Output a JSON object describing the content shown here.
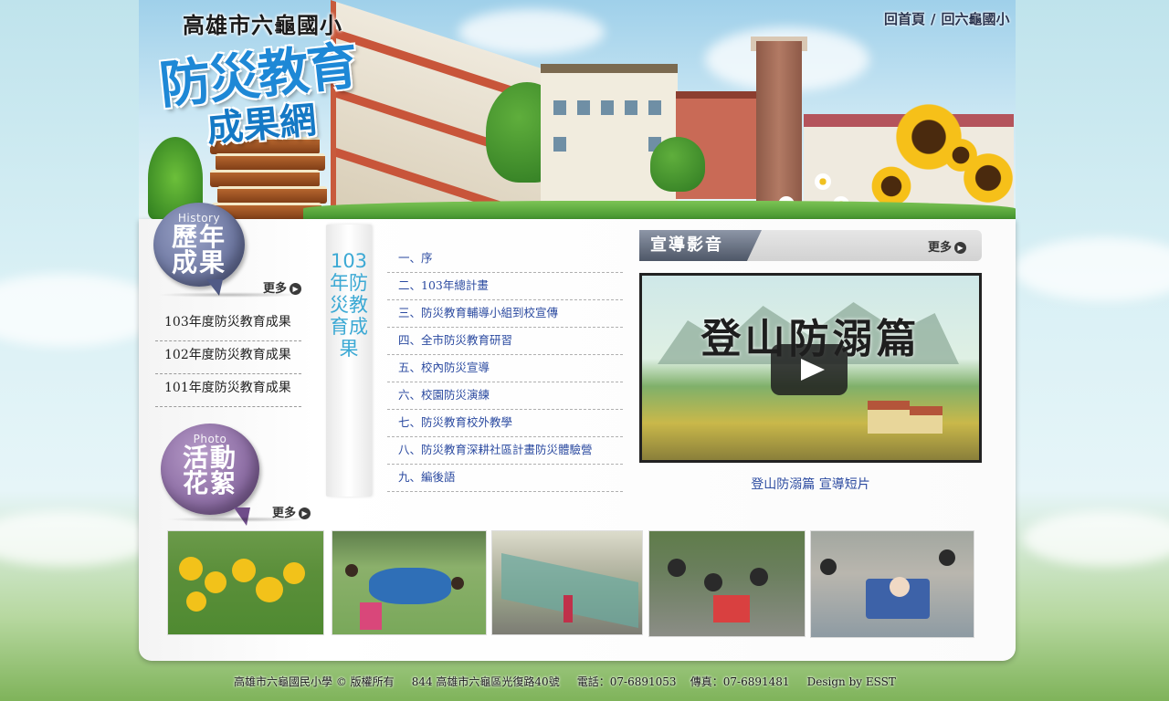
{
  "header": {
    "title_line1": "高雄市六龜國小",
    "title_line2": "防災教育",
    "title_line3": "成果網",
    "top_links": [
      {
        "label": "回首頁"
      },
      {
        "label": "回六龜國小"
      }
    ],
    "top_links_separator": "/"
  },
  "history": {
    "badge_en": "History",
    "badge_zh": "歷年成果",
    "more_label": "更多",
    "items": [
      {
        "label": "103年度防災教育成果"
      },
      {
        "label": "102年度防災教育成果"
      },
      {
        "label": "101年度防災教育成果"
      }
    ]
  },
  "photos": {
    "badge_en": "Photo",
    "badge_zh": "活動花絮",
    "more_label": "更多"
  },
  "plan": {
    "vertical_title": "103年防災教育成果",
    "items": [
      {
        "label": "一、序"
      },
      {
        "label": "二、103年總計畫"
      },
      {
        "label": "三、防災教育輔導小組到校宣傳"
      },
      {
        "label": "四、全市防災教育研習"
      },
      {
        "label": "五、校內防災宣導"
      },
      {
        "label": "六、校園防災演練"
      },
      {
        "label": "七、防災教育校外教學"
      },
      {
        "label": "八、防災教育深耕社區計畫防災體驗營"
      },
      {
        "label": "九、編後語"
      }
    ]
  },
  "video": {
    "section_title": "宣導影音",
    "more_label": "更多",
    "thumbnail_title": "登山防溺篇",
    "caption": "登山防溺篇 宣導短片"
  },
  "footer": {
    "text": "高雄市六龜國民小學 © 版權所有     844 高雄市六龜區光復路40號     電話：07-6891053    傳真：07-6891481     Design by ESST"
  },
  "colors": {
    "accent_blue": "#1e88d6",
    "link_blue": "#2b4aa0",
    "vertical_title_blue": "#3ca9d4"
  }
}
